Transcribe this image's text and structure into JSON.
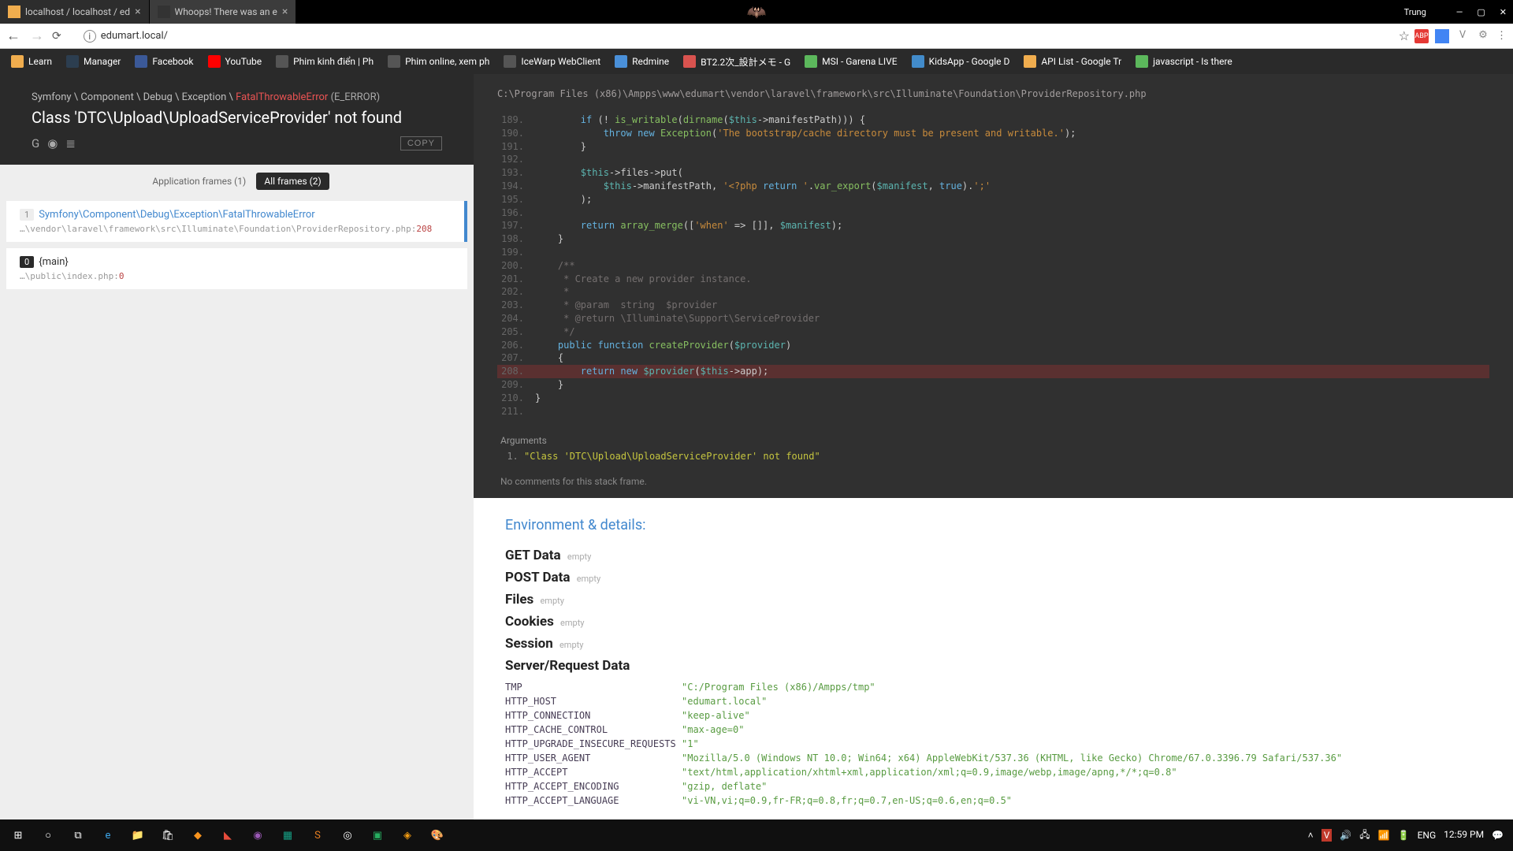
{
  "window": {
    "user": "Trung"
  },
  "tabs": [
    {
      "title": "localhost / localhost / ed",
      "active": false
    },
    {
      "title": "Whoops! There was an e",
      "active": true
    }
  ],
  "url": "edumart.local/",
  "bookmarks": [
    {
      "label": "Learn"
    },
    {
      "label": "Manager"
    },
    {
      "label": "Facebook"
    },
    {
      "label": "YouTube"
    },
    {
      "label": "Phim kinh điển | Ph"
    },
    {
      "label": "Phim online, xem ph"
    },
    {
      "label": "IceWarp WebClient"
    },
    {
      "label": "Redmine"
    },
    {
      "label": "BT2.2次_設計メモ - G"
    },
    {
      "label": "MSI - Garena LIVE"
    },
    {
      "label": "KidsApp - Google D"
    },
    {
      "label": "API List - Google Tr"
    },
    {
      "label": "javascript - Is there"
    }
  ],
  "error": {
    "namespace": "Symfony \\ Component \\ Debug \\ Exception \\ ",
    "class": "FatalThrowableError",
    "type": "(E_ERROR)",
    "message": "Class 'DTC\\Upload\\UploadServiceProvider' not found",
    "copy": "COPY"
  },
  "frameTabs": {
    "app": "Application frames (1)",
    "all": "All frames (2)"
  },
  "frames": [
    {
      "num": "1",
      "class": "Symfony\\Component\\Debug\\Exception\\FatalThrowableError",
      "path": "…\\vendor\\laravel\\framework\\src\\Illuminate\\Foundation\\ProviderRepository.php",
      "line": "208",
      "active": true,
      "link": true
    },
    {
      "num": "0",
      "class": "{main}",
      "path": "…\\public\\index.php",
      "line": "0",
      "active": false,
      "link": false
    }
  ],
  "code": {
    "file": "C:\\Program Files (x86)\\Ampps\\www\\edumart\\vendor\\laravel\\framework\\src\\Illuminate\\Foundation\\ProviderRepository.php",
    "lines": [
      {
        "n": "189",
        "t": "        if (! is_writable(dirname($this->manifestPath))) {"
      },
      {
        "n": "190",
        "t": "            throw new Exception('The bootstrap/cache directory must be present and writable.');"
      },
      {
        "n": "191",
        "t": "        }"
      },
      {
        "n": "192",
        "t": ""
      },
      {
        "n": "193",
        "t": "        $this->files->put("
      },
      {
        "n": "194",
        "t": "            $this->manifestPath, '<?php return '.var_export($manifest, true).';'"
      },
      {
        "n": "195",
        "t": "        );"
      },
      {
        "n": "196",
        "t": ""
      },
      {
        "n": "197",
        "t": "        return array_merge(['when' => []], $manifest);"
      },
      {
        "n": "198",
        "t": "    }"
      },
      {
        "n": "199",
        "t": ""
      },
      {
        "n": "200",
        "t": "    /**"
      },
      {
        "n": "201",
        "t": "     * Create a new provider instance."
      },
      {
        "n": "202",
        "t": "     *"
      },
      {
        "n": "203",
        "t": "     * @param  string  $provider"
      },
      {
        "n": "204",
        "t": "     * @return \\Illuminate\\Support\\ServiceProvider"
      },
      {
        "n": "205",
        "t": "     */"
      },
      {
        "n": "206",
        "t": "    public function createProvider($provider)"
      },
      {
        "n": "207",
        "t": "    {"
      },
      {
        "n": "208",
        "t": "        return new $provider($this->app);",
        "hl": true
      },
      {
        "n": "209",
        "t": "    }"
      },
      {
        "n": "210",
        "t": "}"
      },
      {
        "n": "211",
        "t": ""
      }
    ]
  },
  "arguments": {
    "heading": "Arguments",
    "items": [
      "\"Class 'DTC\\Upload\\UploadServiceProvider' not found\""
    ]
  },
  "noComments": "No comments for this stack frame.",
  "env": {
    "title": "Environment & details:",
    "groups": [
      {
        "name": "GET Data",
        "empty": "empty"
      },
      {
        "name": "POST Data",
        "empty": "empty"
      },
      {
        "name": "Files",
        "empty": "empty"
      },
      {
        "name": "Cookies",
        "empty": "empty"
      },
      {
        "name": "Session",
        "empty": "empty"
      },
      {
        "name": "Server/Request Data",
        "rows": [
          {
            "k": "TMP",
            "v": "\"C:/Program Files (x86)/Ampps/tmp\""
          },
          {
            "k": "HTTP_HOST",
            "v": "\"edumart.local\""
          },
          {
            "k": "HTTP_CONNECTION",
            "v": "\"keep-alive\""
          },
          {
            "k": "HTTP_CACHE_CONTROL",
            "v": "\"max-age=0\""
          },
          {
            "k": "HTTP_UPGRADE_INSECURE_REQUESTS",
            "v": "\"1\""
          },
          {
            "k": "HTTP_USER_AGENT",
            "v": "\"Mozilla/5.0 (Windows NT 10.0; Win64; x64) AppleWebKit/537.36 (KHTML, like Gecko) Chrome/67.0.3396.79 Safari/537.36\""
          },
          {
            "k": "HTTP_ACCEPT",
            "v": "\"text/html,application/xhtml+xml,application/xml;q=0.9,image/webp,image/apng,*/*;q=0.8\""
          },
          {
            "k": "HTTP_ACCEPT_ENCODING",
            "v": "\"gzip, deflate\""
          },
          {
            "k": "HTTP_ACCEPT_LANGUAGE",
            "v": "\"vi-VN,vi;q=0.9,fr-FR;q=0.8,fr;q=0.7,en-US;q=0.6,en;q=0.5\""
          }
        ]
      }
    ]
  },
  "tray": {
    "lang": "ENG",
    "time": "12:59 PM"
  }
}
